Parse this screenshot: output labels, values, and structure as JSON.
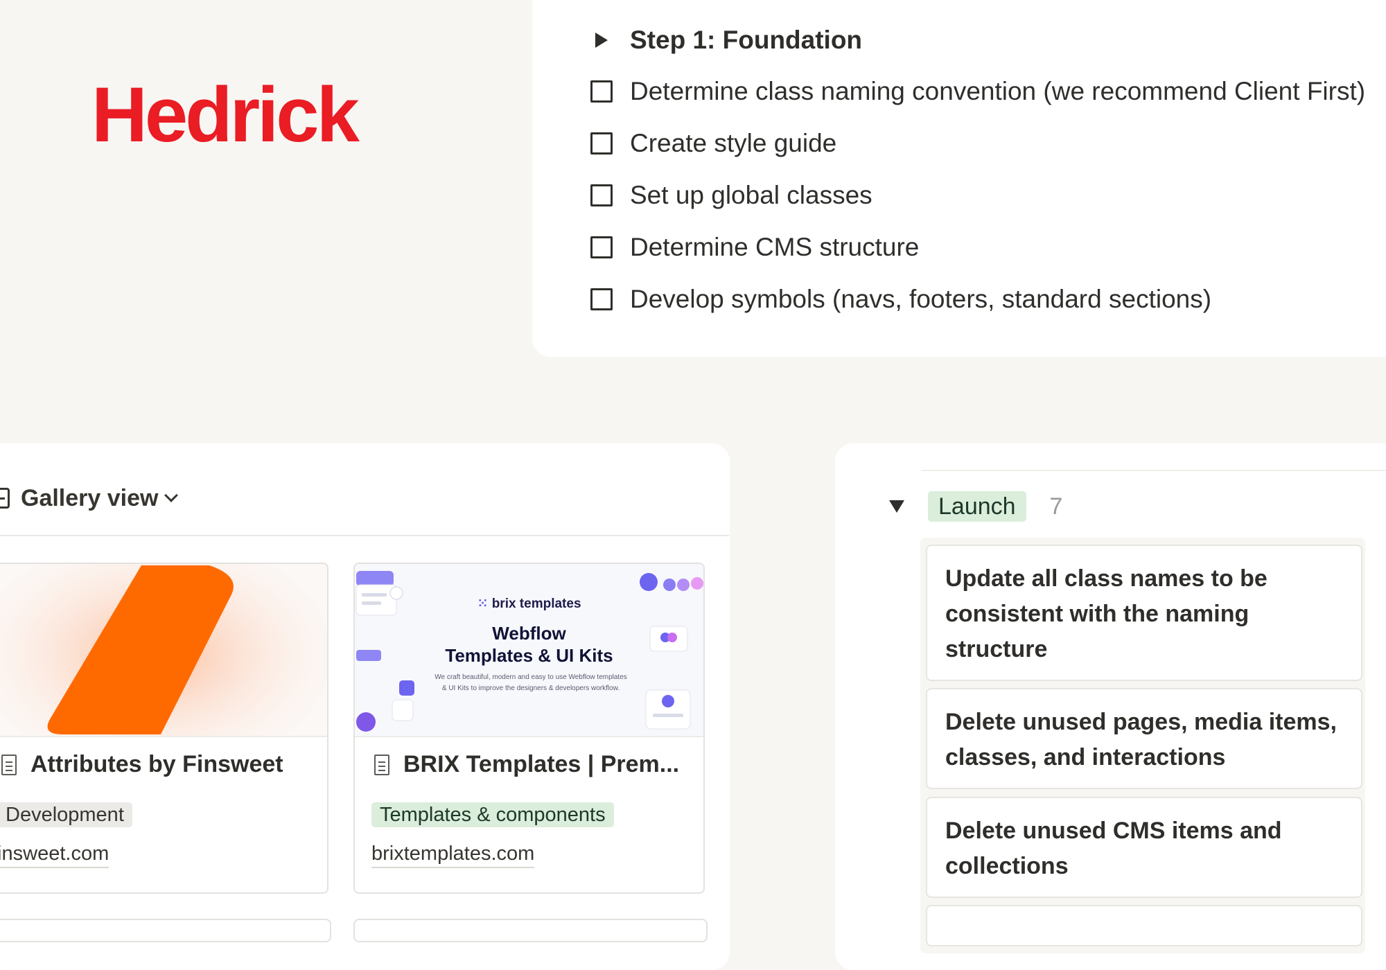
{
  "brand": {
    "logo_text": "Hedrick",
    "logo_color": "#ea1c24"
  },
  "checklist": {
    "toggle_title": "Step 1: Foundation",
    "items": [
      "Determine class naming convention (we recommend Client First)",
      "Create style guide",
      "Set up global classes",
      "Determine CMS structure",
      "Develop symbols (navs, footers, standard sections)"
    ]
  },
  "gallery": {
    "view_label": "Gallery view",
    "cards": [
      {
        "title": "Attributes by Finsweet",
        "tag": "Development",
        "tag_color": "#ebeae7",
        "url": "finsweet.com"
      },
      {
        "title": "BRIX Templates | Prem...",
        "tag": "Templates & components",
        "tag_color": "#dbeddb",
        "url": "brixtemplates.com",
        "cover": {
          "brand": "brix templates",
          "headline_1": "Webflow",
          "headline_2": "Templates & UI Kits",
          "blurb": "We craft beautiful, modern and easy to use Webflow templates & UI Kits to improve the designers & developers workflow."
        }
      }
    ]
  },
  "board": {
    "group_label": "Launch",
    "group_count": "7",
    "cards": [
      "Update all class names to be consistent with the naming structure",
      "Delete unused pages, media items, classes, and interactions",
      "Delete unused CMS items and collections"
    ]
  }
}
